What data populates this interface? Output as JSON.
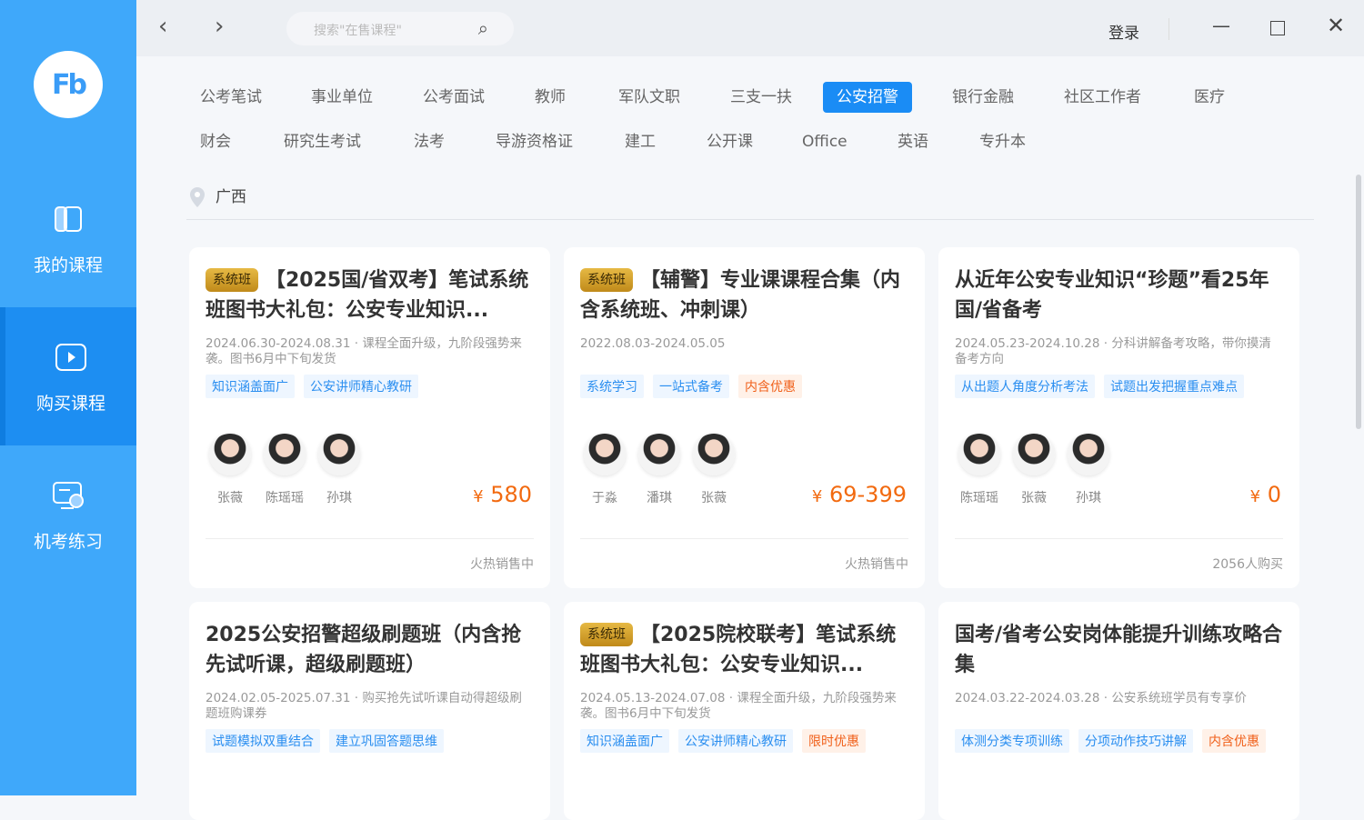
{
  "sidebar": {
    "logo": "Fb",
    "items": [
      {
        "label": "我的课程",
        "icon": "book-icon"
      },
      {
        "label": "购买课程",
        "icon": "play-icon",
        "active": true
      },
      {
        "label": "机考练习",
        "icon": "monitor-clock-icon"
      }
    ]
  },
  "topbar": {
    "search_placeholder": "搜索\"在售课程\"",
    "login": "登录"
  },
  "categories": [
    "公考笔试",
    "事业单位",
    "公考面试",
    "教师",
    "军队文职",
    "三支一扶",
    "公安招警",
    "银行金融",
    "社区工作者",
    "医疗",
    "财会",
    "研究生考试",
    "法考",
    "导游资格证",
    "建工",
    "公开课",
    "Office",
    "英语",
    "专升本"
  ],
  "active_category": "公安招警",
  "location": "广西",
  "colors": {
    "sidebar": "#3fa8fa",
    "accent": "#1a8cf5",
    "price": "#f26a10"
  },
  "cards": [
    {
      "badge": "系统班",
      "title": "【2025国/省双考】笔试系统班图书大礼包：公安专业知识...",
      "desc": "2024.06.30-2024.08.31 · 课程全面升级，九阶段强势来袭。图书6月中下旬发货",
      "tags": [
        "知识涵盖面广",
        "公安讲师精心教研"
      ],
      "orange_tags": [],
      "teachers": [
        "张薇",
        "陈瑶瑶",
        "孙琪"
      ],
      "currency": "¥",
      "price": "580",
      "footer": "火热销售中"
    },
    {
      "badge": "系统班",
      "title": "【辅警】专业课课程合集（内含系统班、冲刺课）",
      "desc": "2022.08.03-2024.05.05",
      "tags": [
        "系统学习",
        "一站式备考"
      ],
      "orange_tags": [
        "内含优惠"
      ],
      "teachers": [
        "于淼",
        "潘琪",
        "张薇"
      ],
      "currency": "¥",
      "price": "69-399",
      "footer": "火热销售中"
    },
    {
      "badge": "",
      "title": "从近年公安专业知识“珍题”看25年国/省备考",
      "desc": "2024.05.23-2024.10.28 · 分科讲解备考攻略，带你摸清备考方向",
      "tags": [
        "从出题人角度分析考法",
        "试题出发把握重点难点"
      ],
      "orange_tags": [],
      "teachers": [
        "陈瑶瑶",
        "张薇",
        "孙琪"
      ],
      "currency": "¥",
      "price": "0",
      "footer": "2056人购买"
    },
    {
      "badge": "",
      "title": "2025公安招警超级刷题班（内含抢先试听课，超级刷题班）",
      "desc": "2024.02.05-2025.07.31 · 购买抢先试听课自动得超级刷题班购课券",
      "tags": [
        "试题模拟双重结合",
        "建立巩固答题思维"
      ],
      "orange_tags": []
    },
    {
      "badge": "系统班",
      "title": "【2025院校联考】笔试系统班图书大礼包：公安专业知识...",
      "desc": "2024.05.13-2024.07.08 · 课程全面升级，九阶段强势来袭。图书6月中下旬发货",
      "tags": [
        "知识涵盖面广",
        "公安讲师精心教研"
      ],
      "orange_tags": [
        "限时优惠"
      ]
    },
    {
      "badge": "",
      "title": "国考/省考公安岗体能提升训练攻略合集",
      "desc": "2024.03.22-2024.03.28 · 公安系统班学员有专享价",
      "tags": [
        "体测分类专项训练",
        "分项动作技巧讲解"
      ],
      "orange_tags": [
        "内含优惠"
      ]
    }
  ]
}
